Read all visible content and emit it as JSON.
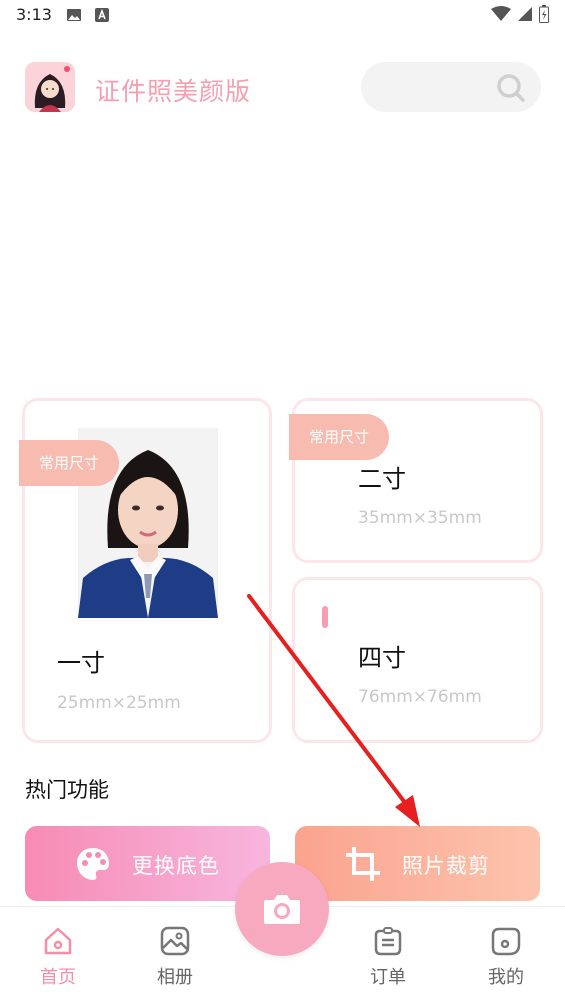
{
  "status_bar": {
    "time": "3:13"
  },
  "header": {
    "app_name": "证件照美颜版",
    "search_placeholder": ""
  },
  "sizes": {
    "one_inch": {
      "tag": "常用尺寸",
      "title": "一寸",
      "dimensions": "25mm×25mm"
    },
    "two_inch": {
      "tag": "常用尺寸",
      "title": "二寸",
      "dimensions": "35mm×35mm"
    },
    "four_inch": {
      "title": "四寸",
      "dimensions": "76mm×76mm"
    }
  },
  "hot_features": {
    "title": "热门功能",
    "change_background": "更换底色",
    "photo_crop": "照片裁剪"
  },
  "bottom_nav": {
    "home": "首页",
    "album": "相册",
    "orders": "订单",
    "mine": "我的"
  },
  "colors": {
    "accent_pink": "#f58fa8",
    "tag_salmon": "#f8bbb0",
    "annotation_red": "#e81f1f"
  },
  "icons": [
    "photo-icon",
    "a-icon",
    "wifi-icon",
    "signal-icon",
    "battery-icon",
    "search-icon",
    "palette-icon",
    "crop-icon",
    "camera-icon",
    "home-icon",
    "album-icon",
    "orders-icon",
    "mine-icon"
  ]
}
